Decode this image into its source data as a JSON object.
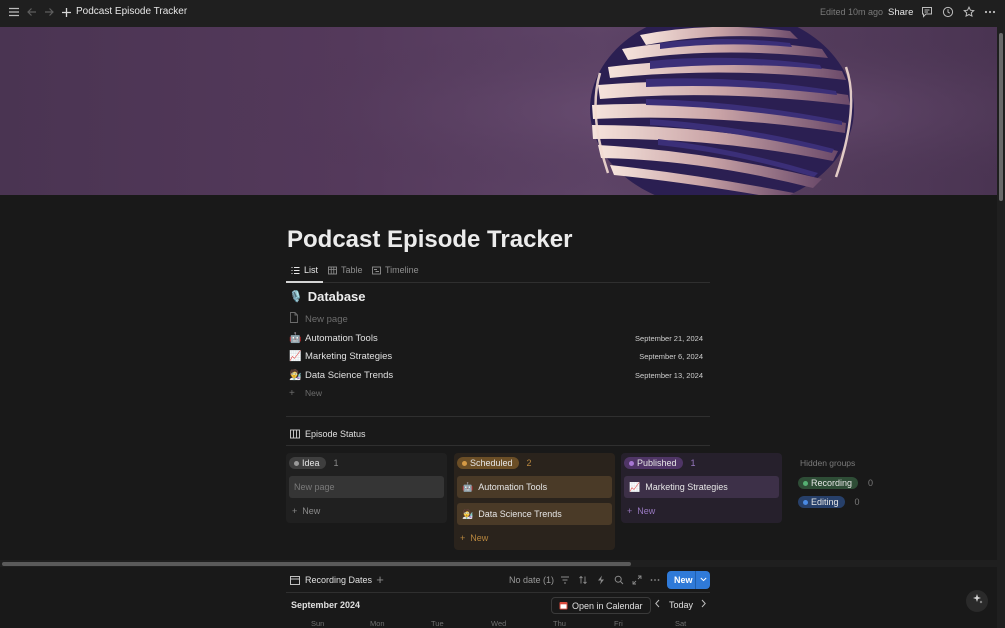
{
  "topbar": {
    "title": "Podcast Episode Tracker",
    "edited": "Edited 10m ago",
    "share": "Share"
  },
  "page": {
    "title": "Podcast Episode Tracker"
  },
  "tabs": [
    {
      "label": "List",
      "active": true
    },
    {
      "label": "Table",
      "active": false
    },
    {
      "label": "Timeline",
      "active": false
    }
  ],
  "database": {
    "icon": "🎙️",
    "title": "Database",
    "rows": [
      {
        "icon": "page-icon",
        "title": "New page",
        "date": ""
      },
      {
        "icon": "🤖",
        "title": "Automation Tools",
        "date": "September 21, 2024"
      },
      {
        "icon": "📈",
        "title": "Marketing Strategies",
        "date": "September 6, 2024"
      },
      {
        "icon": "🧑‍🔬",
        "title": "Data Science Trends",
        "date": "September 13, 2024"
      }
    ],
    "new_label": "New"
  },
  "board": {
    "title": "Episode Status",
    "columns": [
      {
        "label": "Idea",
        "count": "1",
        "color": "#6b6b6b",
        "cards": [
          {
            "icon": "",
            "title": "New page"
          }
        ],
        "new_label": "New"
      },
      {
        "label": "Scheduled",
        "count": "2",
        "color": "#c4893c",
        "cards": [
          {
            "icon": "🤖",
            "title": "Automation Tools"
          },
          {
            "icon": "🧑‍🔬",
            "title": "Data Science Trends"
          }
        ],
        "new_label": "New"
      },
      {
        "label": "Published",
        "count": "1",
        "color": "#9b6bc9",
        "cards": [
          {
            "icon": "📈",
            "title": "Marketing Strategies"
          }
        ],
        "new_label": "New"
      }
    ],
    "hidden_groups_label": "Hidden groups",
    "hidden_groups": [
      {
        "label": "Recording",
        "count": "0",
        "color": "#4e9e6a"
      },
      {
        "label": "Editing",
        "count": "0",
        "color": "#3f7fd6"
      }
    ]
  },
  "calendar": {
    "title": "Recording Dates",
    "no_date": "No date (1)",
    "new_label": "New",
    "month": "September 2024",
    "open_label": "Open in Calendar",
    "today_label": "Today",
    "weekdays": [
      "Sun",
      "Mon",
      "Tue",
      "Wed",
      "Thu",
      "Fri",
      "Sat"
    ]
  },
  "colors": {
    "accent": "#2f7ad8",
    "background": "#191919"
  }
}
